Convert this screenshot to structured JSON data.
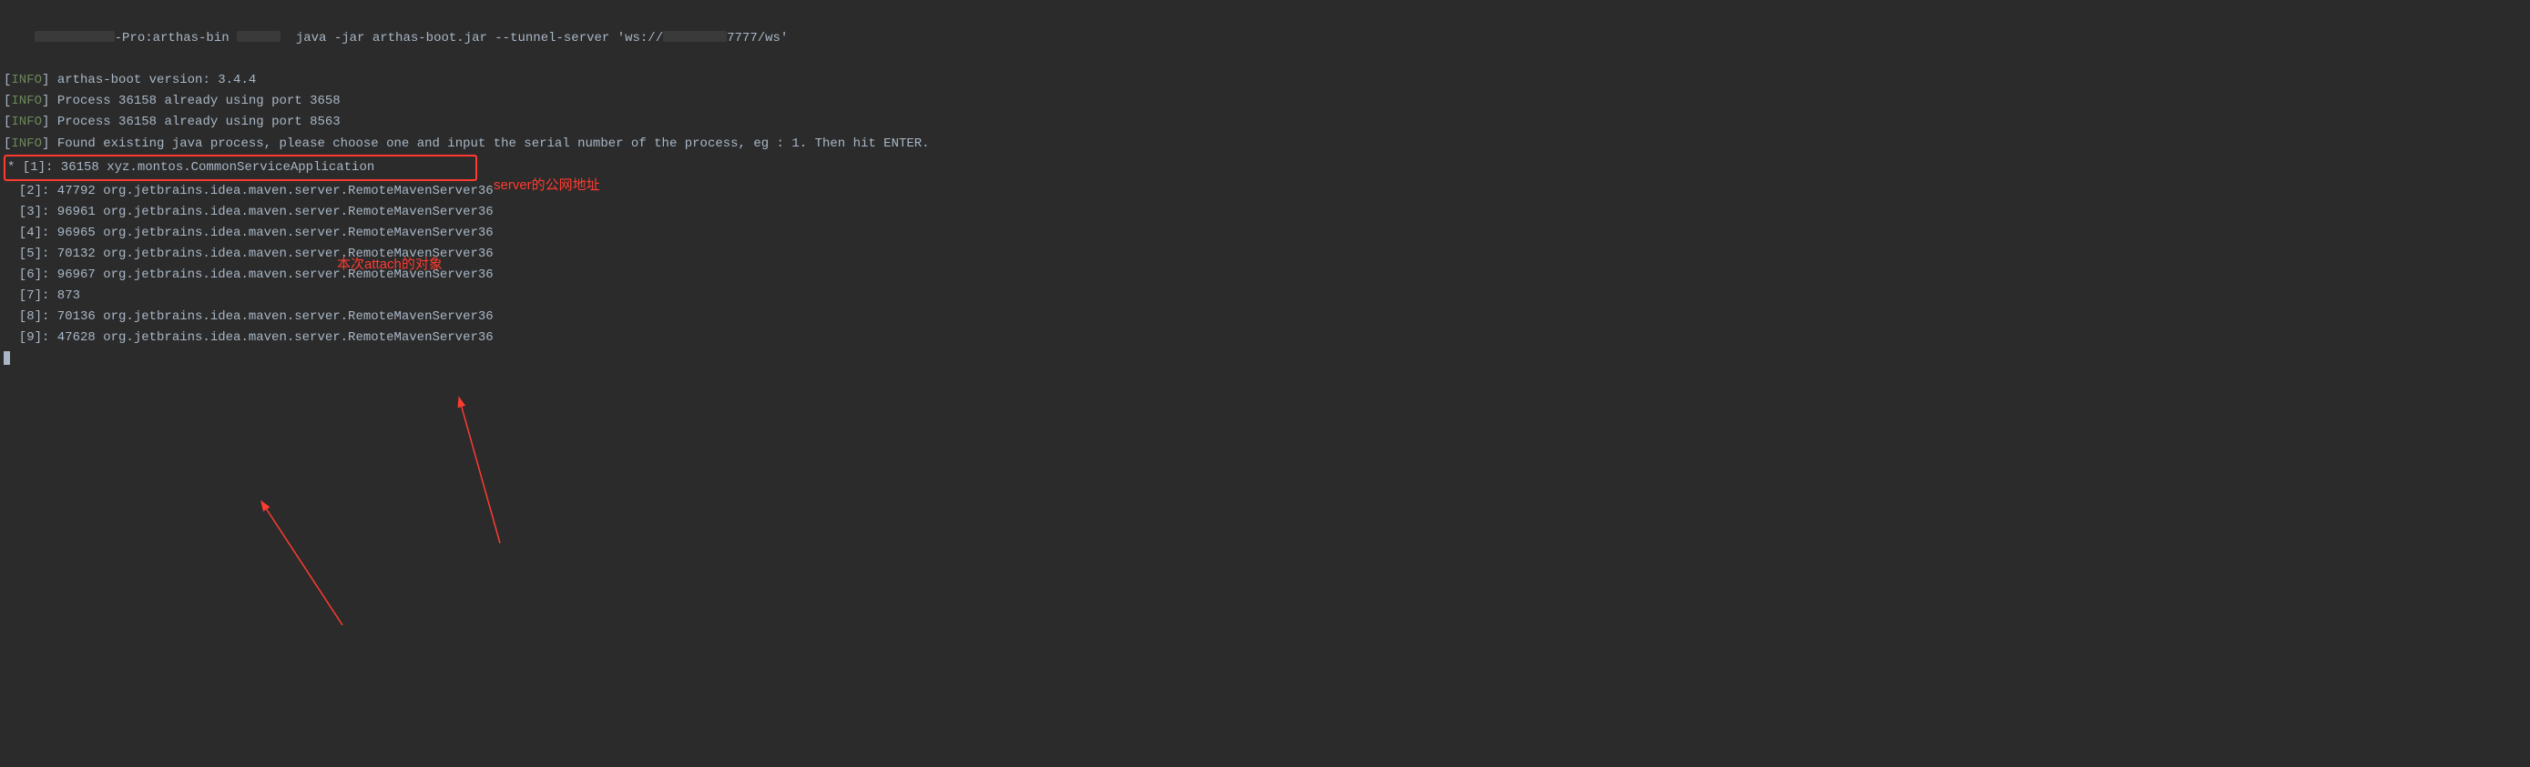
{
  "prompt": {
    "host_suffix": "-Pro:arthas-bin ",
    "command": "java -jar arthas-boot.jar --tunnel-server 'ws://",
    "command_suffix": "7777/ws'"
  },
  "lines": {
    "info_label": "INFO",
    "version": "arthas-boot version: 3.4.4",
    "port1": "Process 36158 already using port 3658",
    "port2": "Process 36158 already using port 8563",
    "found": "Found existing java process, please choose one and input the serial number of the process, eg : 1. Then hit ENTER.",
    "selected": "* [1]: 36158 xyz.montos.CommonServiceApplication",
    "p2": "  [2]: 47792 org.jetbrains.idea.maven.server.RemoteMavenServer36",
    "p3": "  [3]: 96961 org.jetbrains.idea.maven.server.RemoteMavenServer36",
    "p4": "  [4]: 96965 org.jetbrains.idea.maven.server.RemoteMavenServer36",
    "p5": "  [5]: 70132 org.jetbrains.idea.maven.server.RemoteMavenServer36",
    "p6": "  [6]: 96967 org.jetbrains.idea.maven.server.RemoteMavenServer36",
    "p7": "  [7]: 873 ",
    "p8": "  [8]: 70136 org.jetbrains.idea.maven.server.RemoteMavenServer36",
    "p9": "  [9]: 47628 org.jetbrains.idea.maven.server.RemoteMavenServer36"
  },
  "annotations": {
    "attach_target": "本次attach的对象",
    "server_addr": "server的公网地址"
  }
}
